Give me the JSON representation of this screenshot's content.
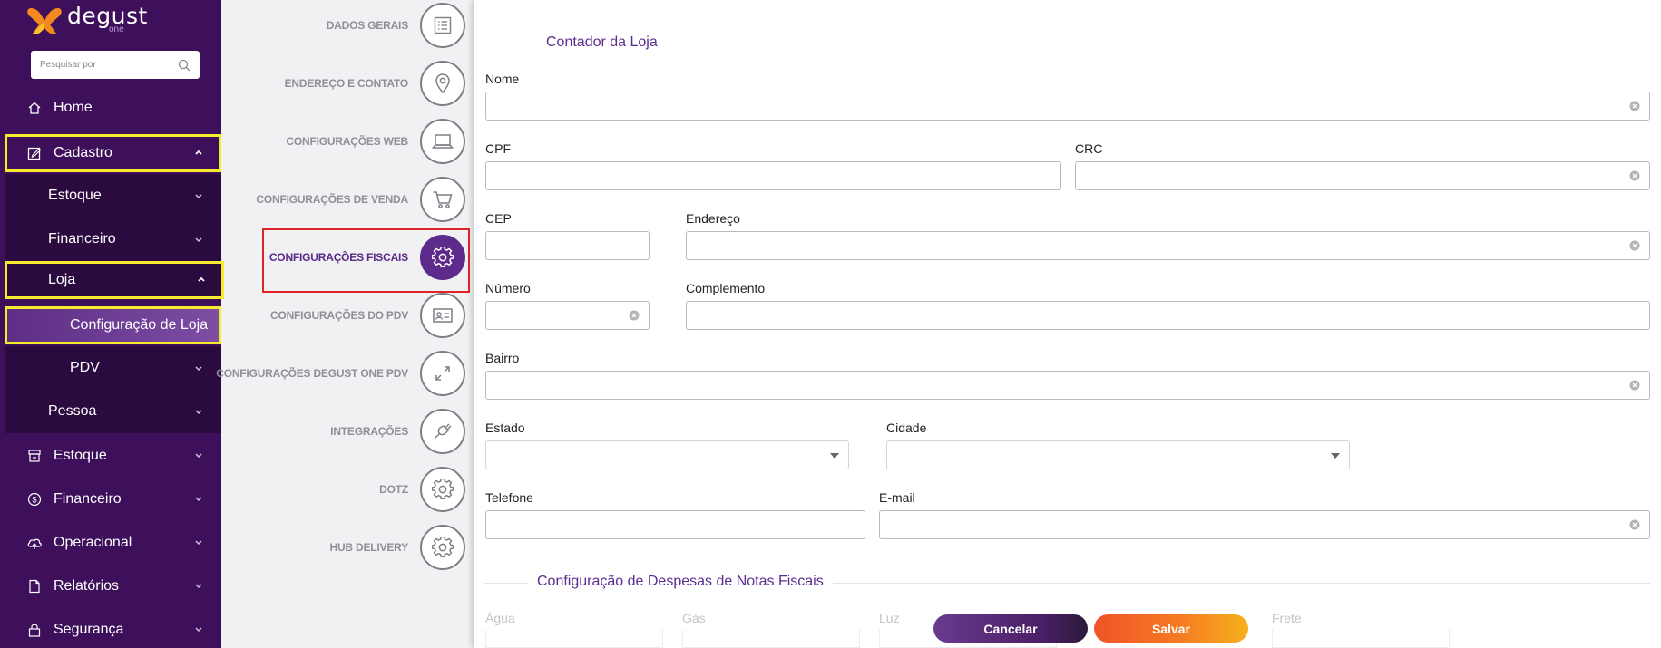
{
  "app": {
    "brand": "degust",
    "brand_sub": "one"
  },
  "search": {
    "placeholder": "Pesquisar por"
  },
  "sidebar": {
    "items": [
      {
        "label": "Home",
        "icon": "home-icon"
      },
      {
        "label": "Cadastro",
        "icon": "edit-icon",
        "expanded": true
      },
      {
        "label": "Estoque"
      },
      {
        "label": "Financeiro"
      },
      {
        "label": "Loja",
        "expanded": true
      },
      {
        "label": "Configuração de Loja",
        "active": true
      },
      {
        "label": "PDV"
      },
      {
        "label": "Pessoa"
      },
      {
        "label": "Estoque",
        "icon": "store-icon"
      },
      {
        "label": "Financeiro",
        "icon": "dollar-icon"
      },
      {
        "label": "Operacional",
        "icon": "cloud-icon"
      },
      {
        "label": "Relatórios",
        "icon": "document-icon"
      },
      {
        "label": "Segurança",
        "icon": "lock-icon"
      }
    ]
  },
  "steps": [
    {
      "label": "DADOS GERAIS",
      "icon": "list-icon"
    },
    {
      "label": "ENDEREÇO E CONTATO",
      "icon": "location-pin-icon"
    },
    {
      "label": "CONFIGURAÇÕES WEB",
      "icon": "laptop-icon"
    },
    {
      "label": "CONFIGURAÇÕES DE VENDA",
      "icon": "cart-icon"
    },
    {
      "label": "CONFIGURAÇÕES FISCAIS",
      "icon": "gear-icon",
      "active": true
    },
    {
      "label": "CONFIGURAÇÕES DO PDV",
      "icon": "id-card-icon"
    },
    {
      "label": "CONFIGURAÇÕES DEGUST ONE PDV",
      "icon": "expand-arrows-icon"
    },
    {
      "label": "INTEGRAÇÕES",
      "icon": "plug-icon"
    },
    {
      "label": "DOTZ",
      "icon": "gear-icon"
    },
    {
      "label": "HUB DELIVERY",
      "icon": "gear-icon"
    }
  ],
  "form": {
    "section_contador": "Contador da Loja",
    "labels": {
      "nome": "Nome",
      "cpf": "CPF",
      "crc": "CRC",
      "cep": "CEP",
      "endereco": "Endereço",
      "numero": "Número",
      "complemento": "Complemento",
      "bairro": "Bairro",
      "estado": "Estado",
      "cidade": "Cidade",
      "telefone": "Telefone",
      "email": "E-mail"
    },
    "values": {
      "nome": "",
      "cpf": "",
      "crc": "",
      "cep": "",
      "endereco": "",
      "numero": "",
      "complemento": "",
      "bairro": "",
      "estado": "",
      "cidade": "",
      "telefone": "",
      "email": ""
    },
    "section_despesas": "Configuração de Despesas de Notas Fiscais",
    "despesas_labels": {
      "agua": "Água",
      "gas": "Gás",
      "luz": "Luz",
      "frete": "Frete"
    }
  },
  "actions": {
    "cancel": "Cancelar",
    "save": "Salvar"
  },
  "colors": {
    "sidebar_bg": "#3e0f5a",
    "submenu_bg": "#2b0a3f",
    "accent_purple": "#5d2b8c",
    "highlight_yellow": "#f5ea2c",
    "highlight_red": "#e02424",
    "save_orange": "#f57a22"
  }
}
